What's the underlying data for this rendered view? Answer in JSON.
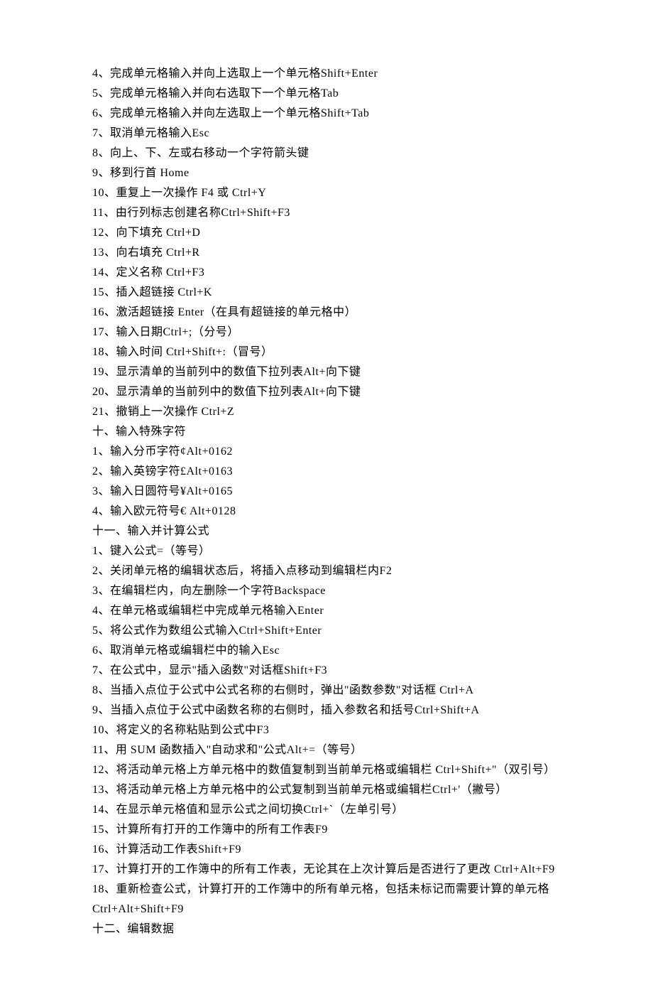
{
  "lines": [
    "4、完成单元格输入并向上选取上一个单元格Shift+Enter",
    "5、完成单元格输入并向右选取下一个单元格Tab",
    "6、完成单元格输入并向左选取上一个单元格Shift+Tab",
    "7、取消单元格输入Esc",
    "8、向上、下、左或右移动一个字符箭头键",
    "9、移到行首 Home",
    "10、重复上一次操作 F4 或 Ctrl+Y",
    "11、由行列标志创建名称Ctrl+Shift+F3",
    "12、向下填充 Ctrl+D",
    "13、向右填充 Ctrl+R",
    "14、定义名称 Ctrl+F3",
    "15、插入超链接 Ctrl+K",
    "16、激活超链接 Enter（在具有超链接的单元格中）",
    "17、输入日期Ctrl+;（分号）",
    "18、输入时间 Ctrl+Shift+:（冒号）",
    "19、显示清单的当前列中的数值下拉列表Alt+向下键",
    "20、显示清单的当前列中的数值下拉列表Alt+向下键",
    "21、撤销上一次操作 Ctrl+Z",
    "十、输入特殊字符",
    "1、输入分币字符¢Alt+0162",
    "2、输入英镑字符£Alt+0163",
    "3、输入日圆符号¥Alt+0165",
    "4、输入欧元符号€ Alt+0128",
    "十一、输入并计算公式",
    "1、键入公式=（等号）",
    "2、关闭单元格的编辑状态后，将插入点移动到编辑栏内F2",
    "3、在编辑栏内，向左删除一个字符Backspace",
    "4、在单元格或编辑栏中完成单元格输入Enter",
    "5、将公式作为数组公式输入Ctrl+Shift+Enter",
    "6、取消单元格或编辑栏中的输入Esc",
    "7、在公式中，显示\"插入函数\"对话框Shift+F3",
    "8、当插入点位于公式中公式名称的右侧时，弹出\"函数参数\"对话框 Ctrl+A",
    "9、当插入点位于公式中函数名称的右侧时，插入参数名和括号Ctrl+Shift+A",
    "10、将定义的名称粘贴到公式中F3",
    "11、用 SUM 函数插入\"自动求和\"公式Alt+=（等号）",
    "12、将活动单元格上方单元格中的数值复制到当前单元格或编辑栏 Ctrl+Shift+\"（双引号）",
    "13、将活动单元格上方单元格中的公式复制到当前单元格或编辑栏Ctrl+'（撇号）",
    "14、在显示单元格值和显示公式之间切换Ctrl+`（左单引号）",
    "15、计算所有打开的工作簿中的所有工作表F9",
    "16、计算活动工作表Shift+F9",
    "17、计算打开的工作簿中的所有工作表，无论其在上次计算后是否进行了更改 Ctrl+Alt+F9",
    "18、重新检查公式，计算打开的工作簿中的所有单元格，包括未标记而需要计算的单元格Ctrl+Alt+Shift+F9",
    "十二、编辑数据"
  ]
}
